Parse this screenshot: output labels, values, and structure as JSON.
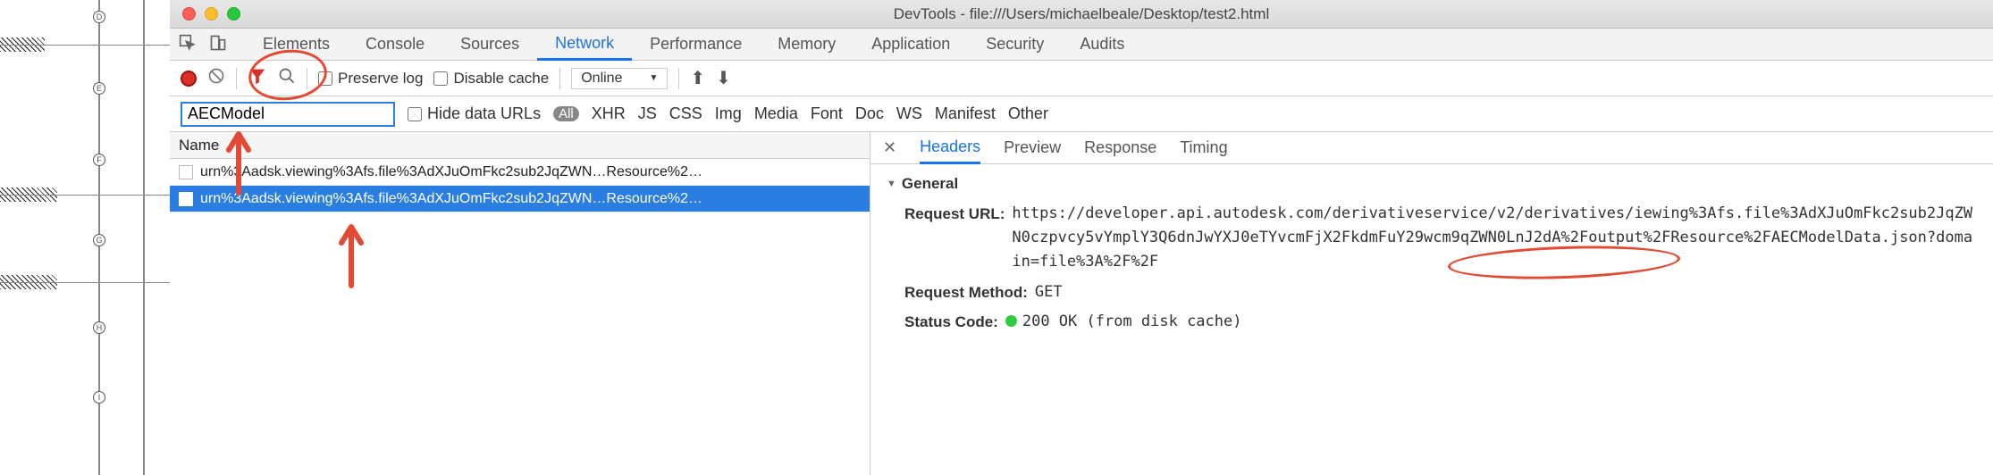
{
  "window": {
    "title": "DevTools - file:///Users/michaelbeale/Desktop/test2.html"
  },
  "tabs": [
    "Elements",
    "Console",
    "Sources",
    "Network",
    "Performance",
    "Memory",
    "Application",
    "Security",
    "Audits"
  ],
  "tabs_active_index": 3,
  "toolbar": {
    "preserve_log": "Preserve log",
    "disable_cache": "Disable cache",
    "online": "Online"
  },
  "filter": {
    "value": "AECModel",
    "hide_data_urls": "Hide data URLs",
    "types": [
      "All",
      "XHR",
      "JS",
      "CSS",
      "Img",
      "Media",
      "Font",
      "Doc",
      "WS",
      "Manifest",
      "Other"
    ]
  },
  "columns": {
    "name": "Name"
  },
  "requests": [
    {
      "name": "urn%3Aadsk.viewing%3Afs.file%3AdXJuOmFkc2sub2JqZWN…Resource%2…"
    },
    {
      "name": "urn%3Aadsk.viewing%3Afs.file%3AdXJuOmFkc2sub2JqZWN…Resource%2…"
    }
  ],
  "selected_request_index": 1,
  "detail_tabs": [
    "Headers",
    "Preview",
    "Response",
    "Timing"
  ],
  "detail_tab_active_index": 0,
  "headers": {
    "section_general": "General",
    "request_url_label": "Request URL:",
    "request_url_value": "https://developer.api.autodesk.com/derivativeservice/v2/derivatives/iewing%3Afs.file%3AdXJuOmFkc2sub2JqZWN0czpvcy5vYmplY3Q6dnJwYXJ0eTYvcmFjX2FkdmFuY29wcm9qZWN0LnJ2dA%2Foutput%2FResource%2FAECModelData.json?domain=file%3A%2F%2F",
    "request_method_label": "Request Method:",
    "request_method_value": "GET",
    "status_code_label": "Status Code:",
    "status_code_value": "200 OK (from disk cache)"
  },
  "icons": {
    "inspect": "inspect-icon",
    "device": "device-toolbar-icon",
    "record": "record-icon",
    "clear": "clear-icon",
    "filter": "filter-icon",
    "search": "search-icon",
    "upload": "upload-icon",
    "download": "download-icon",
    "close": "close-icon"
  },
  "annotation_colors": {
    "red": "#e34a33"
  },
  "cad_labels": [
    "D",
    "E",
    "F",
    "G",
    "H",
    "I"
  ]
}
